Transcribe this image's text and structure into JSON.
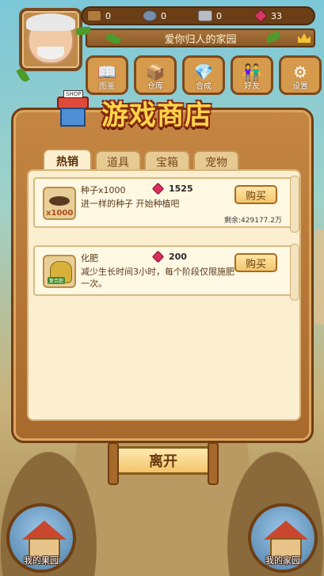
{
  "header": {
    "resources": [
      {
        "icon": "wood-icon",
        "value": "0"
      },
      {
        "icon": "ore-icon",
        "value": "0"
      },
      {
        "icon": "stone-icon",
        "value": "0"
      },
      {
        "icon": "gem-icon",
        "value": "33"
      }
    ],
    "home_name": "爱你归人的家园"
  },
  "nav": {
    "items": [
      {
        "name": "book",
        "label": "图鉴",
        "glyph": "📖"
      },
      {
        "name": "box",
        "label": "仓库",
        "glyph": "📦"
      },
      {
        "name": "gems",
        "label": "合成",
        "glyph": "💎"
      },
      {
        "name": "friends",
        "label": "好友",
        "glyph": "👫"
      },
      {
        "name": "settings",
        "label": "设置",
        "glyph": "⚙"
      }
    ]
  },
  "shop": {
    "title": "游戏商店",
    "icon_tag": "SHOP",
    "tabs": [
      "热销",
      "道具",
      "宝箱",
      "宠物"
    ],
    "active_tab": "热销",
    "items": [
      {
        "name": "种子x1000",
        "desc": "进一样的种子 开始种植吧",
        "price": "1525",
        "qty_label": "x1000",
        "buy_label": "购买",
        "remain": "剩余:429177.2万"
      },
      {
        "name": "化肥",
        "desc": "减少生长时间3小时，每个阶段仅限施肥一次。",
        "price": "200",
        "tag": "复合肥",
        "buy_label": "购买"
      }
    ],
    "leave_label": "离开"
  },
  "bottom": {
    "left_label": "我的果园",
    "right_label": "我的家园"
  },
  "colors": {
    "gem": "#d8305a",
    "title_yellow": "#ffd54a",
    "panel_wood": "#c58643",
    "paper": "#fbefcf"
  }
}
